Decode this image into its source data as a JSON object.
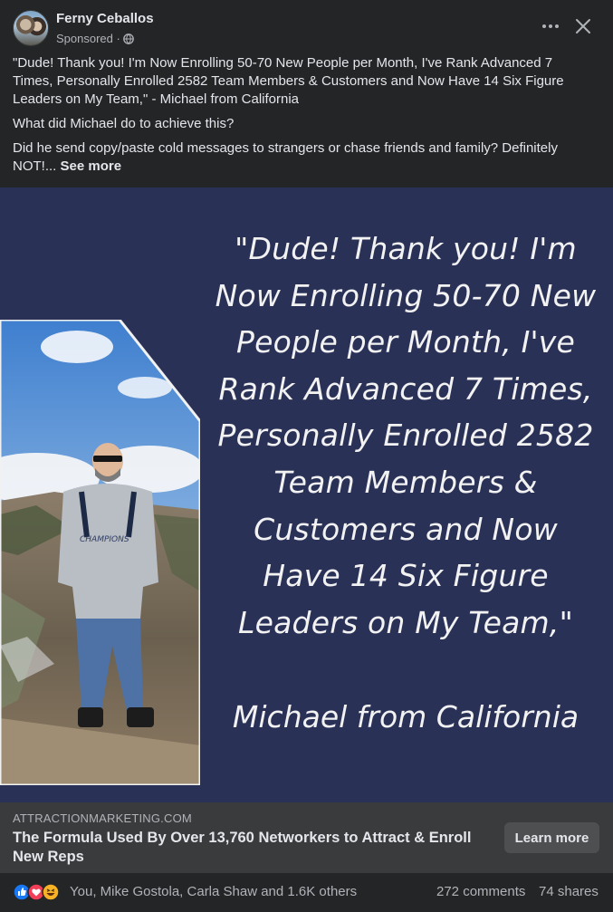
{
  "post": {
    "author": "Ferny Ceballos",
    "sponsored_label": "Sponsored ·",
    "caption": {
      "paragraph_1": "\"Dude! Thank you! I'm Now Enrolling 50-70 New People per Month, I've Rank Advanced 7 Times, Personally Enrolled 2582 Team Members & Customers and Now Have 14 Six Figure Leaders on My Team,\" - Michael from California",
      "paragraph_2": "What did Michael do to achieve this?",
      "paragraph_3": "Did he send copy/paste cold messages to strangers or chase friends and family? Definitely NOT!...",
      "see_more": "See more"
    },
    "icons": {
      "privacy": "globe-icon",
      "more": "more-options-icon",
      "close": "close-icon"
    }
  },
  "creative": {
    "quote_lines": [
      "\"Dude! Thank you! I'm",
      "Now Enrolling 50-70 New",
      "People per Month, I've",
      "Rank Advanced 7 Times,",
      "Personally Enrolled 2582",
      "Team Members &",
      "Customers and Now",
      "Have 14 Six Figure",
      "Leaders on My Team,\""
    ],
    "attribution": "Michael from California",
    "shirt_text": "CHAMPIONS",
    "background_color": "#2a3157"
  },
  "link": {
    "domain": "ATTRACTIONMARKETING.COM",
    "headline": "The Formula Used By Over 13,760 Networkers to Attract & Enroll New Reps",
    "cta": "Learn more"
  },
  "footer": {
    "reactions": [
      "like-icon",
      "love-icon",
      "haha-icon"
    ],
    "reaction_names": "You, Mike Gostola, Carla Shaw and 1.6K others",
    "comments": "272 comments",
    "shares": "74 shares"
  }
}
